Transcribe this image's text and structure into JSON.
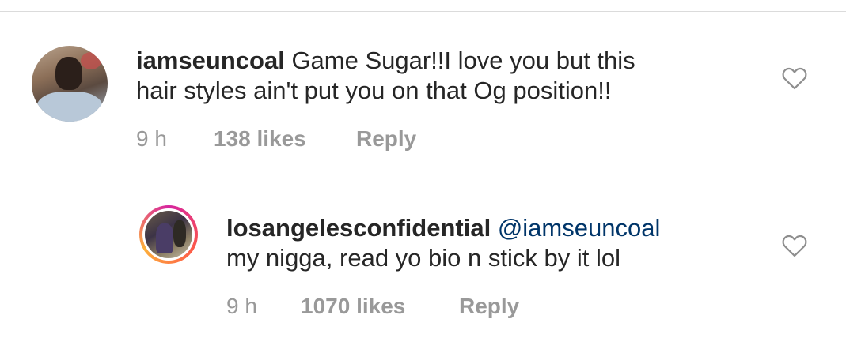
{
  "comments": [
    {
      "username": "iamseuncoal",
      "text_line1": "Game Sugar!!I love you but this",
      "text_line2": "hair styles ain't put you on that Og position!!",
      "time": "9 h",
      "likes": "138 likes",
      "reply": "Reply",
      "like_icon": "heart-outline-icon"
    },
    {
      "username": "losangelesconfidential",
      "mention": "@iamseuncoal",
      "text_line2": "my nigga, read yo bio n stick by it lol",
      "time": "9 h",
      "likes": "1070 likes",
      "reply": "Reply",
      "like_icon": "heart-outline-icon"
    }
  ],
  "colors": {
    "text": "#262626",
    "meta": "#999999",
    "mention": "#003569",
    "divider": "#dbdbdb"
  }
}
